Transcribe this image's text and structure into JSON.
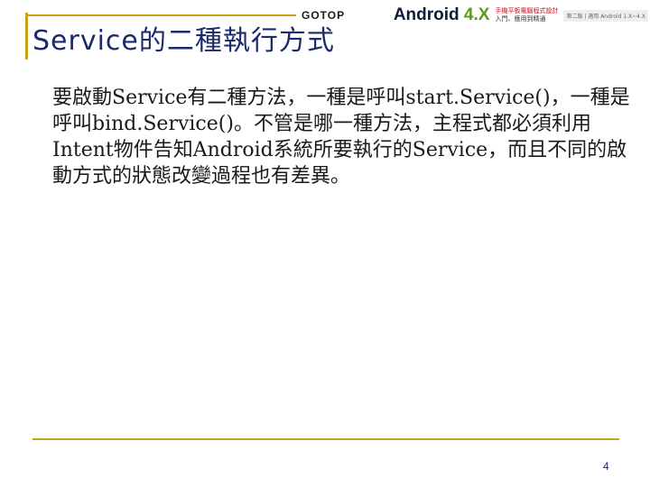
{
  "slide": {
    "title": "Service的二種執行方式",
    "body": "要啟動Service有二種方法，一種是呼叫start.Service()，一種是呼叫bind.Service()。不管是哪一種方法，主程式都必須利用Intent物件告知Android系統所要執行的Service，而且不同的啟動方式的狀態改變過程也有差異。",
    "page_number": "4"
  },
  "header": {
    "publisher": "GOTOP",
    "book_title": "Android ",
    "book_version": "4.X",
    "book_sub_line1": "手機平板電腦程式設計",
    "book_sub_line2": "入門、應用到精通",
    "book_tag": "第二版 | 適用 Android 1.X~4.X"
  },
  "colors": {
    "accent": "#c9a21a",
    "title": "#1a2a6c",
    "android_green": "#5b9b1a"
  },
  "icons": {
    "logo": "android-robot-icon"
  }
}
